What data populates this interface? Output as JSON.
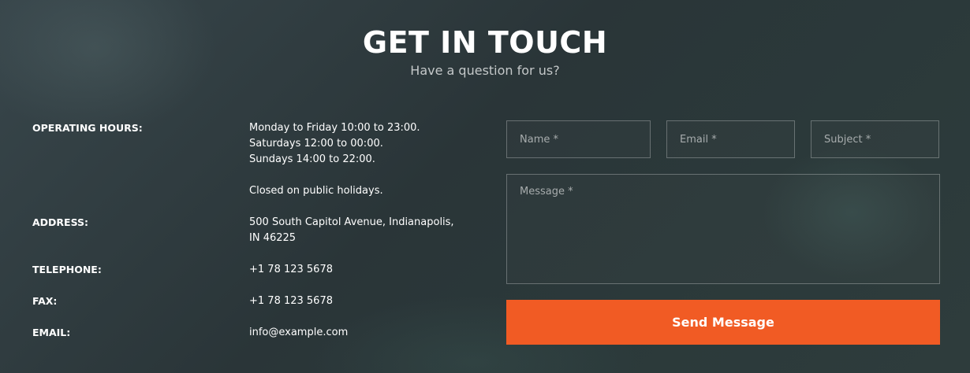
{
  "header": {
    "title": "GET IN TOUCH",
    "subtitle": "Have a question for us?"
  },
  "info": {
    "hours_label": "OPERATING HOURS:",
    "hours_lines": [
      "Monday to Friday 10:00 to 23:00.",
      "Saturdays 12:00 to 00:00.",
      "Sundays 14:00 to 22:00.",
      "Closed on public holidays."
    ],
    "address_label": "ADDRESS:",
    "address_lines": [
      "500 South Capitol Avenue, Indianapolis,",
      "IN 46225"
    ],
    "telephone_label": "TELEPHONE:",
    "telephone_value": "+1 78 123 5678",
    "fax_label": "FAX:",
    "fax_value": "+1 78 123 5678",
    "email_label": "EMAIL:",
    "email_value": "info@example.com"
  },
  "form": {
    "name_placeholder": "Name *",
    "email_placeholder": "Email *",
    "subject_placeholder": "Subject *",
    "message_placeholder": "Message *",
    "send_label": "Send Message"
  },
  "colors": {
    "accent": "#f15b24",
    "background": "#2c383b"
  }
}
